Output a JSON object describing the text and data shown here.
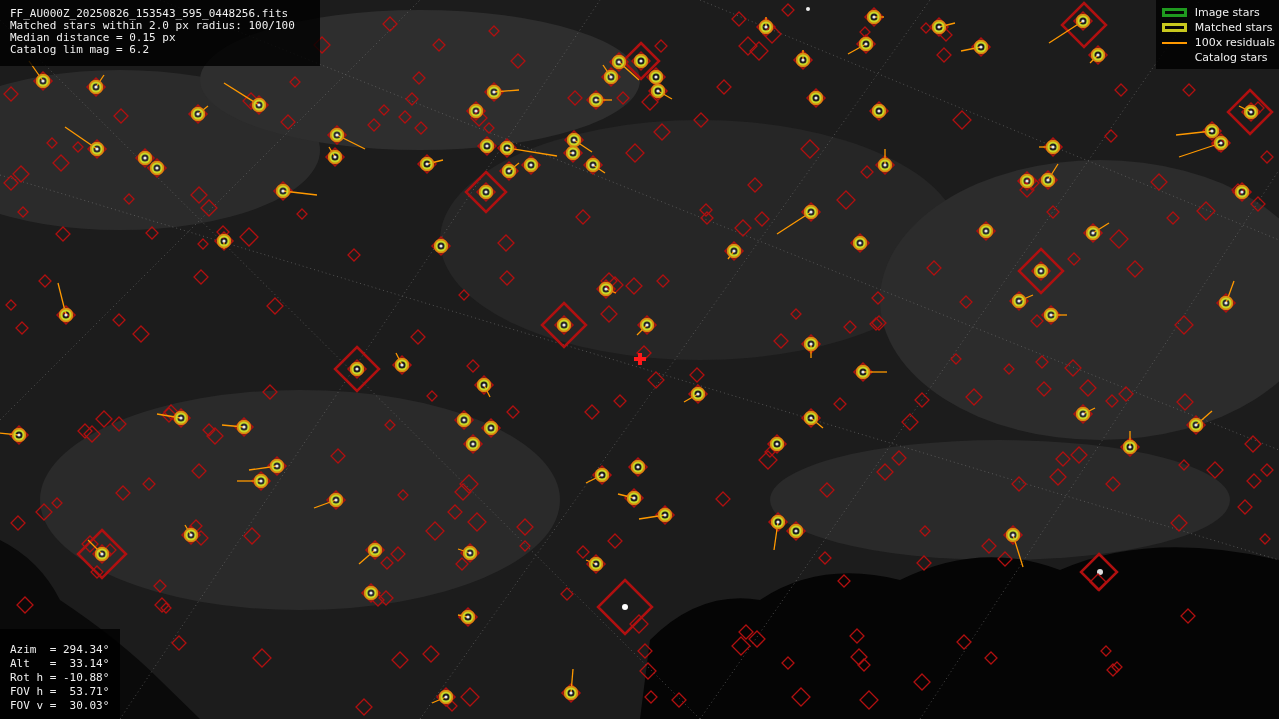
{
  "info_panel": {
    "lines": [
      "FF_AU000Z_20250826_153543_595_0448256.fits",
      "Matched stars within 2.0 px radius: 100/100",
      "Median distance = 0.15 px",
      "Catalog lim mag = 6.2"
    ]
  },
  "legend": {
    "items": [
      {
        "label": "Image stars",
        "color": "#1f9a1f"
      },
      {
        "kind": "matched",
        "label": "Matched stars",
        "color": "#c8c81e"
      },
      {
        "kind": "residual",
        "label": "100x residuals",
        "color": "#ff9900"
      },
      {
        "kind": "catalog",
        "label": "Catalog stars"
      }
    ]
  },
  "pointing_panel": {
    "lines": [
      "Azim  = 294.34°",
      "Alt   =  33.14°",
      "Rot h = -10.88°",
      "FOV h =  53.71°",
      "FOV v =  30.03°"
    ]
  }
}
